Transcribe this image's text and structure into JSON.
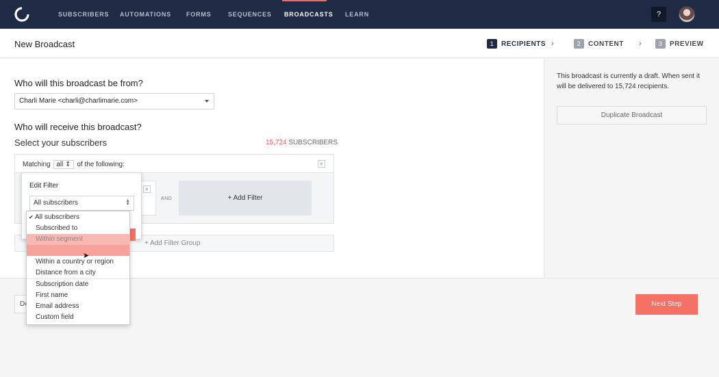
{
  "nav": {
    "items": [
      "SUBSCRIBERS",
      "AUTOMATIONS",
      "FORMS",
      "SEQUENCES",
      "BROADCASTS",
      "LEARN"
    ],
    "active": "BROADCASTS",
    "help_label": "?",
    "accent_color": "#f06b5f"
  },
  "header": {
    "title": "New Broadcast",
    "steps": [
      {
        "num": "1",
        "label": "RECIPIENTS"
      },
      {
        "num": "2",
        "label": "CONTENT"
      },
      {
        "num": "3",
        "label": "PREVIEW"
      }
    ],
    "chevron": "›"
  },
  "main": {
    "from_question": "Who will this broadcast be from?",
    "from_value": "Charli Marie <charli@charlimarie.com>",
    "receive_question": "Who will receive this broadcast?",
    "select_subscribers": "Select your subscribers",
    "subscriber_count": "15,724",
    "subscriber_count_label": "SUBSCRIBERS",
    "matching_prefix": "Matching",
    "matching_value": "all",
    "matching_suffix": "of the following:",
    "and_label": "AND",
    "add_filter": "+ Add Filter",
    "add_filter_group": "+ Add Filter Group"
  },
  "popover": {
    "title": "Edit Filter",
    "select_value": "All subscribers",
    "options": [
      "All subscribers",
      "Subscribed to",
      "Within segment",
      "",
      "Within a country or region",
      "Distance from a city",
      "Subscription date",
      "First name",
      "Email address",
      "Custom field"
    ],
    "checkmark": "✔"
  },
  "aside": {
    "draft_text": "This broadcast is currently a draft. When sent it will be delivered to 15,724 recipients.",
    "duplicate_button": "Duplicate Broadcast"
  },
  "footer": {
    "back_button": "De",
    "next_button": "Next Step"
  },
  "colors": {
    "nav_bg": "#1f2a44",
    "primary_button": "#f47065",
    "highlight_option": "#f8b9b3"
  }
}
